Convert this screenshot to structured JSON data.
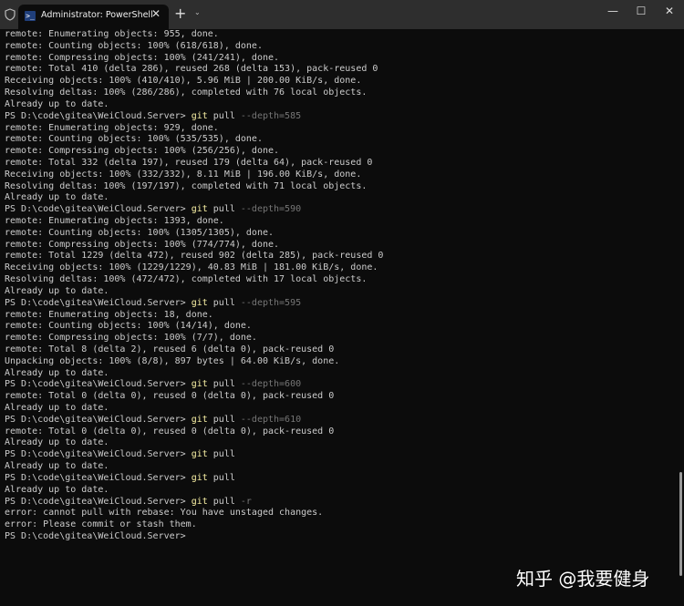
{
  "window": {
    "tab_title": "Administrator: PowerShell",
    "tab_close": "✕",
    "new_tab": "+",
    "tab_dropdown": "⌄",
    "minimize": "—",
    "maximize": "☐",
    "close": "✕"
  },
  "terminal": {
    "lines": [
      {
        "text": "remote: Enumerating objects: 955, done."
      },
      {
        "text": "remote: Counting objects: 100% (618/618), done."
      },
      {
        "text": "remote: Compressing objects: 100% (241/241), done."
      },
      {
        "text": "remote: Total 410 (delta 286), reused 268 (delta 153), pack-reused 0"
      },
      {
        "text": "Receiving objects: 100% (410/410), 5.96 MiB | 200.00 KiB/s, done."
      },
      {
        "text": "Resolving deltas: 100% (286/286), completed with 76 local objects."
      },
      {
        "text": "Already up to date."
      },
      {
        "prompt": "PS D:\\code\\gitea\\WeiCloud.Server> ",
        "cmd": "git",
        "args": " pull",
        "opt": " --depth=585"
      },
      {
        "text": "remote: Enumerating objects: 929, done."
      },
      {
        "text": "remote: Counting objects: 100% (535/535), done."
      },
      {
        "text": "remote: Compressing objects: 100% (256/256), done."
      },
      {
        "text": "remote: Total 332 (delta 197), reused 179 (delta 64), pack-reused 0"
      },
      {
        "text": "Receiving objects: 100% (332/332), 8.11 MiB | 196.00 KiB/s, done."
      },
      {
        "text": "Resolving deltas: 100% (197/197), completed with 71 local objects."
      },
      {
        "text": "Already up to date."
      },
      {
        "prompt": "PS D:\\code\\gitea\\WeiCloud.Server> ",
        "cmd": "git",
        "args": " pull",
        "opt": " --depth=590"
      },
      {
        "text": "remote: Enumerating objects: 1393, done."
      },
      {
        "text": "remote: Counting objects: 100% (1305/1305), done."
      },
      {
        "text": "remote: Compressing objects: 100% (774/774), done."
      },
      {
        "text": "remote: Total 1229 (delta 472), reused 902 (delta 285), pack-reused 0"
      },
      {
        "text": "Receiving objects: 100% (1229/1229), 40.83 MiB | 181.00 KiB/s, done."
      },
      {
        "text": "Resolving deltas: 100% (472/472), completed with 17 local objects."
      },
      {
        "text": "Already up to date."
      },
      {
        "prompt": "PS D:\\code\\gitea\\WeiCloud.Server> ",
        "cmd": "git",
        "args": " pull",
        "opt": " --depth=595"
      },
      {
        "text": "remote: Enumerating objects: 18, done."
      },
      {
        "text": "remote: Counting objects: 100% (14/14), done."
      },
      {
        "text": "remote: Compressing objects: 100% (7/7), done."
      },
      {
        "text": "remote: Total 8 (delta 2), reused 6 (delta 0), pack-reused 0"
      },
      {
        "text": "Unpacking objects: 100% (8/8), 897 bytes | 64.00 KiB/s, done."
      },
      {
        "text": "Already up to date."
      },
      {
        "prompt": "PS D:\\code\\gitea\\WeiCloud.Server> ",
        "cmd": "git",
        "args": " pull",
        "opt": " --depth=600"
      },
      {
        "text": "remote: Total 0 (delta 0), reused 0 (delta 0), pack-reused 0"
      },
      {
        "text": "Already up to date."
      },
      {
        "prompt": "PS D:\\code\\gitea\\WeiCloud.Server> ",
        "cmd": "git",
        "args": " pull",
        "opt": " --depth=610"
      },
      {
        "text": "remote: Total 0 (delta 0), reused 0 (delta 0), pack-reused 0"
      },
      {
        "text": "Already up to date."
      },
      {
        "prompt": "PS D:\\code\\gitea\\WeiCloud.Server> ",
        "cmd": "git",
        "args": " pull",
        "opt": ""
      },
      {
        "text": "Already up to date."
      },
      {
        "prompt": "PS D:\\code\\gitea\\WeiCloud.Server> ",
        "cmd": "git",
        "args": " pull",
        "opt": ""
      },
      {
        "text": "Already up to date."
      },
      {
        "prompt": "PS D:\\code\\gitea\\WeiCloud.Server> ",
        "cmd": "git",
        "args": " pull",
        "opt": " -r"
      },
      {
        "text": "error: cannot pull with rebase: You have unstaged changes."
      },
      {
        "text": "error: Please commit or stash them."
      },
      {
        "prompt": "PS D:\\code\\gitea\\WeiCloud.Server>",
        "cmd": "",
        "args": "",
        "opt": ""
      }
    ]
  },
  "watermark": "知乎 @我要健身",
  "colors": {
    "background": "#0c0c0c",
    "titlebar": "#2e2e2e",
    "command": "#f9f1a5",
    "option": "#767676",
    "text": "#cccccc"
  }
}
